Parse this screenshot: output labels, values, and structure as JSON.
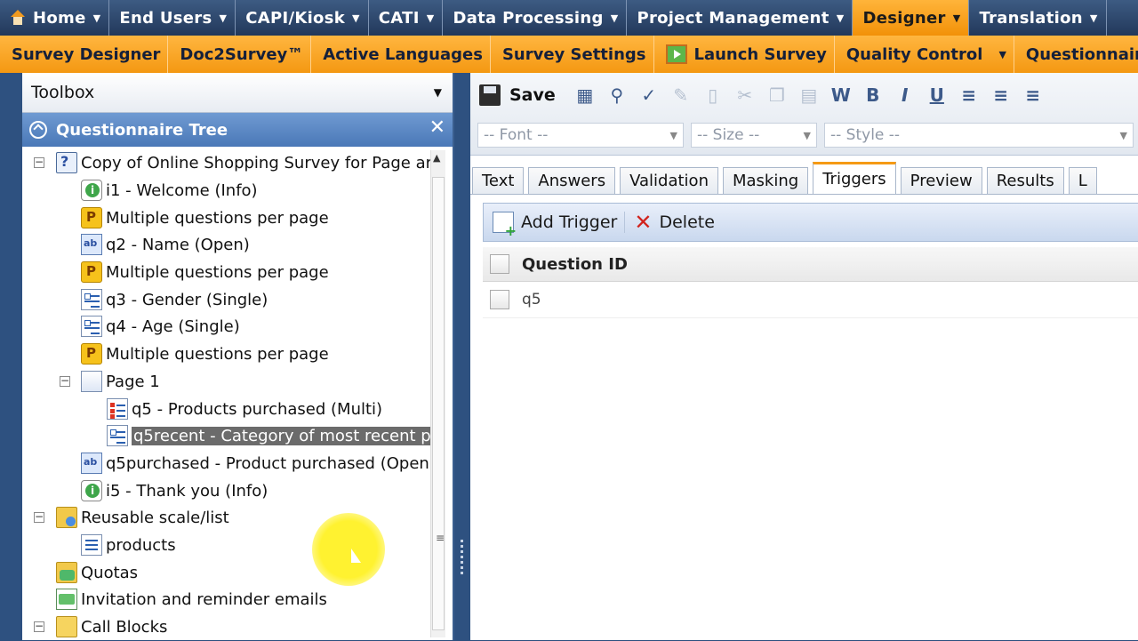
{
  "top_menu": [
    {
      "label": "Home",
      "icon": "home-icon",
      "active": false
    },
    {
      "label": "End Users",
      "active": false
    },
    {
      "label": "CAPI/Kiosk",
      "active": false
    },
    {
      "label": "CATI",
      "active": false
    },
    {
      "label": "Data Processing",
      "active": false
    },
    {
      "label": "Project Management",
      "active": false
    },
    {
      "label": "Designer",
      "active": true
    },
    {
      "label": "Translation",
      "active": false
    }
  ],
  "sub_menu": [
    {
      "label": "Survey Designer"
    },
    {
      "label": "Doc2Survey™"
    },
    {
      "label": "Active Languages"
    },
    {
      "label": "Survey Settings"
    },
    {
      "label": "Launch Survey",
      "icon": "launch-icon"
    },
    {
      "label": "Quality Control",
      "dropdown": true
    },
    {
      "label": "Questionnaire Revi"
    }
  ],
  "toolbox": {
    "title": "Toolbox"
  },
  "tree": {
    "title": "Questionnaire Tree",
    "items": [
      {
        "label": "Copy of Online Shopping Survey for Page ar",
        "icon": "survey",
        "level": 0,
        "expander": "−"
      },
      {
        "label": "i1 - Welcome (Info)",
        "icon": "info",
        "level": 1
      },
      {
        "label": "Multiple questions per page",
        "icon": "page-multi",
        "level": 1
      },
      {
        "label": "q2 - Name (Open)",
        "icon": "open",
        "level": 1
      },
      {
        "label": "Multiple questions per page",
        "icon": "page-multi",
        "level": 1
      },
      {
        "label": "q3 - Gender (Single)",
        "icon": "single",
        "level": 1
      },
      {
        "label": "q4 - Age (Single)",
        "icon": "single",
        "level": 1
      },
      {
        "label": "Multiple questions per page",
        "icon": "page-multi",
        "level": 1
      },
      {
        "label": "Page 1",
        "icon": "page",
        "level": 1,
        "expander": "−"
      },
      {
        "label": "q5 - Products purchased (Multi)",
        "icon": "multi",
        "level": 2
      },
      {
        "label": "q5recent - Category of most recent p",
        "icon": "single",
        "level": 2,
        "selected": true
      },
      {
        "label": "q5purchased - Product purchased (Open",
        "icon": "open",
        "level": 1
      },
      {
        "label": "i5 - Thank you (Info)",
        "icon": "info",
        "level": 1
      },
      {
        "label": "Reusable scale/list",
        "icon": "folder",
        "level": 0,
        "expander": "−"
      },
      {
        "label": "products",
        "icon": "list",
        "level": 1
      },
      {
        "label": "Quotas",
        "icon": "quota",
        "level": 0
      },
      {
        "label": "Invitation and reminder emails",
        "icon": "mail",
        "level": 0
      },
      {
        "label": "Call Blocks",
        "icon": "callblk",
        "level": 0,
        "expander": "−"
      }
    ]
  },
  "editor": {
    "save_label": "Save",
    "font_placeholder": "-- Font --",
    "size_placeholder": "-- Size --",
    "style_placeholder": "-- Style --",
    "bold": "B",
    "italic": "I",
    "underline": "U"
  },
  "tabs": [
    {
      "label": "Text",
      "active": false
    },
    {
      "label": "Answers",
      "active": false
    },
    {
      "label": "Validation",
      "active": false
    },
    {
      "label": "Masking",
      "active": false
    },
    {
      "label": "Triggers",
      "active": true
    },
    {
      "label": "Preview",
      "active": false
    },
    {
      "label": "Results",
      "active": false
    },
    {
      "label": "L",
      "active": false
    }
  ],
  "triggers": {
    "add_label": "Add Trigger",
    "delete_label": "Delete",
    "column_header": "Question ID",
    "rows": [
      {
        "question_id": "q5"
      }
    ]
  }
}
